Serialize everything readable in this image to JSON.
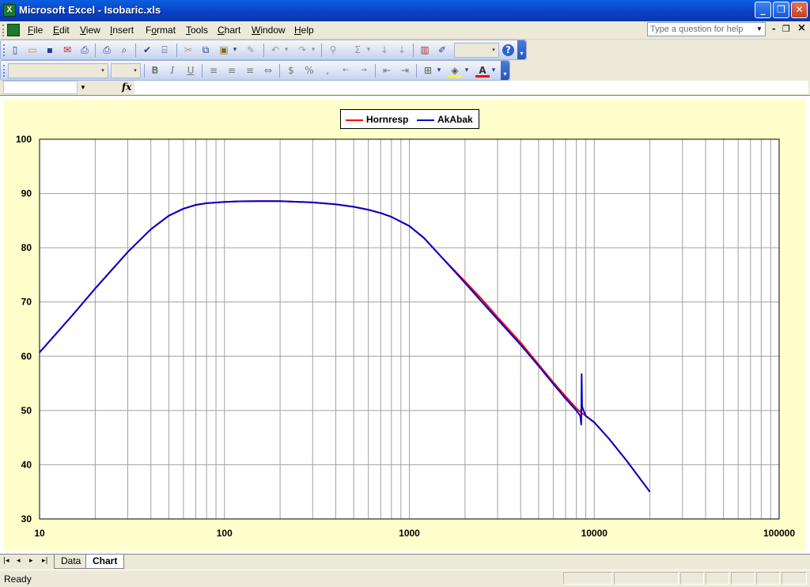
{
  "window": {
    "title": "Microsoft Excel - Isobaric.xls",
    "minimize_glyph": "_",
    "restore_glyph": "❐",
    "close_glyph": "✕"
  },
  "menubar": {
    "items": [
      {
        "u": "F",
        "rest": "ile"
      },
      {
        "u": "E",
        "rest": "dit"
      },
      {
        "u": "V",
        "rest": "iew"
      },
      {
        "u": "I",
        "rest": "nsert"
      },
      {
        "pre": "F",
        "u": "o",
        "rest": "rmat"
      },
      {
        "u": "T",
        "rest": "ools"
      },
      {
        "u": "C",
        "rest": "hart"
      },
      {
        "u": "W",
        "rest": "indow"
      },
      {
        "u": "H",
        "rest": "elp"
      }
    ],
    "help_placeholder": "Type a question for help",
    "doc_minimize_glyph": "-",
    "doc_restore_glyph": "❐",
    "doc_close_glyph": "×"
  },
  "toolbar_standard": {
    "icons": [
      "new-icon",
      "open-icon",
      "save-icon",
      "permission-icon",
      "email-icon",
      "print-icon",
      "print-preview-icon",
      "spelling-icon",
      "research-icon",
      "cut-icon",
      "copy-icon",
      "paste-icon",
      "format-painter-icon",
      "undo-icon",
      "redo-icon",
      "hyperlink-icon",
      "autosum-icon",
      "sort-ascending-icon",
      "sort-descending-icon",
      "chart-wizard-icon",
      "drawing-icon",
      "help-icon"
    ],
    "glyphs": {
      "new": "▯",
      "open": "▭",
      "save": "▪",
      "permission": "✉",
      "email": "⎙",
      "print": "⎙",
      "preview": "⌕",
      "spelling": "✔",
      "research": "⌸",
      "cut": "✂",
      "copy": "⧉",
      "paste": "▣",
      "format_painter": "✎",
      "undo": "↶",
      "redo": "↷",
      "hyperlink": "⚲",
      "autosum": "Σ",
      "sort_asc": "↓",
      "sort_desc": "↓",
      "chart_wizard": "▥",
      "drawing": "✐",
      "help": "?",
      "dropdown": "▾",
      "chevron": "▾"
    }
  },
  "toolbar_formatting": {
    "bold": "B",
    "italic": "I",
    "underline": "U",
    "currency": "$",
    "percent": "%",
    "glyphs": {
      "align_left": "≡",
      "center": "≡",
      "align_right": "≡",
      "merge": "⇔",
      "comma": ",",
      "inc_decimal": "←",
      "dec_decimal": "→",
      "dec_indent": "⇤",
      "inc_indent": "⇥",
      "borders": "⊞",
      "fill": "◈",
      "font_color": "A",
      "dropdown": "▾",
      "chevron": "▾"
    },
    "fill_color": "#ffff00",
    "font_color": "#ff0000"
  },
  "formula_bar": {
    "fx_label": "fx",
    "name_box_arrow": "▼"
  },
  "chart_data": {
    "type": "line",
    "x_scale": "log",
    "xlim": [
      10,
      100000
    ],
    "ylim": [
      30,
      100
    ],
    "x_ticks": [
      "10",
      "100",
      "1000",
      "10000",
      "100000"
    ],
    "y_ticks": [
      "30",
      "40",
      "50",
      "60",
      "70",
      "80",
      "90",
      "100"
    ],
    "grid": true,
    "legend_position": "top-center",
    "plot_bg": "#ffffff",
    "chart_bg": "#ffffcc",
    "series": [
      {
        "name": "Hornresp",
        "color": "#ff0000",
        "x": [
          10,
          15,
          20,
          30,
          40,
          50,
          60,
          70,
          80,
          100,
          120,
          150,
          200,
          300,
          400,
          500,
          600,
          700,
          800,
          1000,
          1200,
          1500,
          2000,
          2500,
          3000,
          4000,
          5000,
          6000,
          7000,
          8000,
          8500,
          9000,
          10000,
          12000,
          15000,
          20000
        ],
        "y": [
          60.7,
          67.5,
          72.5,
          79.2,
          83.4,
          85.9,
          87.2,
          87.9,
          88.2,
          88.45,
          88.55,
          88.6,
          88.6,
          88.35,
          88.0,
          87.55,
          87.0,
          86.4,
          85.7,
          84.0,
          81.8,
          78.2,
          73.8,
          70.3,
          67.2,
          62.5,
          58.5,
          55.2,
          52.6,
          50.4,
          49.6,
          49.0,
          47.8,
          44.8,
          40.7,
          35.0
        ]
      },
      {
        "name": "AkAbak",
        "color": "#0000cc",
        "x": [
          10,
          15,
          20,
          30,
          40,
          50,
          60,
          70,
          80,
          100,
          120,
          150,
          200,
          300,
          400,
          500,
          600,
          700,
          800,
          1000,
          1200,
          1500,
          2000,
          2500,
          3000,
          4000,
          5000,
          6000,
          7000,
          8000,
          8400,
          8500,
          8550,
          8600,
          8650,
          8700,
          9000,
          10000,
          12000,
          15000,
          20000
        ],
        "y": [
          60.7,
          67.5,
          72.5,
          79.2,
          83.4,
          85.9,
          87.2,
          87.9,
          88.2,
          88.45,
          88.55,
          88.6,
          88.6,
          88.35,
          88.0,
          87.55,
          87.0,
          86.4,
          85.7,
          84.0,
          81.8,
          78.2,
          73.5,
          69.8,
          66.8,
          62.1,
          58.2,
          54.9,
          52.2,
          50.0,
          49.0,
          47.4,
          56.7,
          50.8,
          50.5,
          50.2,
          49.0,
          47.8,
          44.8,
          40.7,
          35.0
        ]
      }
    ]
  },
  "sheet_tabs": {
    "nav": [
      "|◂",
      "◂",
      "▸",
      "▸|"
    ],
    "tabs": [
      "Data",
      "Chart"
    ],
    "active": "Chart"
  },
  "status": {
    "text": "Ready"
  }
}
